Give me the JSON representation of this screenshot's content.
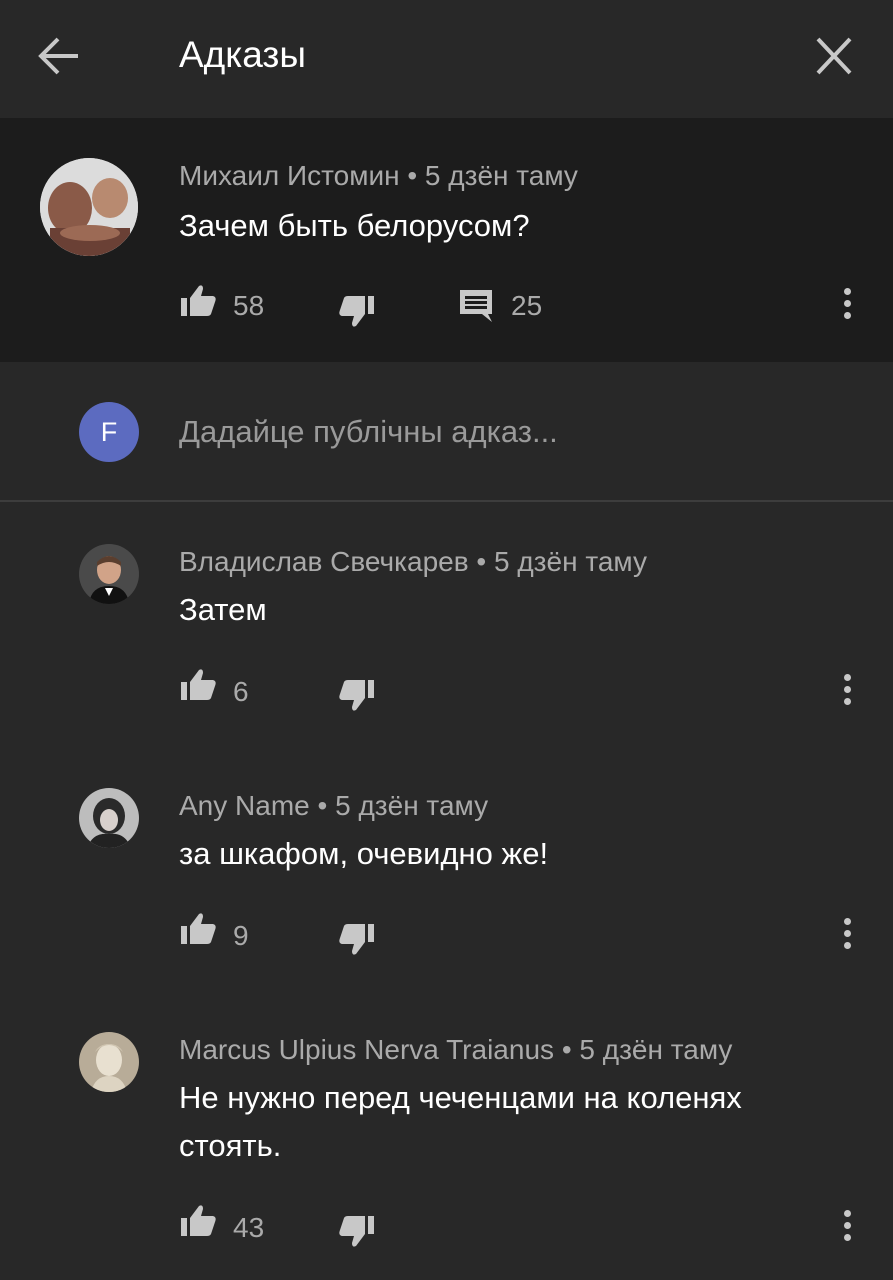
{
  "header": {
    "title": "Адказы",
    "back_icon": "arrow-left-icon",
    "close_icon": "close-icon"
  },
  "parent_comment": {
    "author": "Михаил Истомин",
    "time": "5 дзён таму",
    "text": "Зачем быть белорусом?",
    "likes": "58",
    "replies": "25"
  },
  "reply_box": {
    "avatar_letter": "F",
    "placeholder": "Дадайце публічны адказ..."
  },
  "replies": [
    {
      "author": "Владислав Свечкарев",
      "time": "5 дзён таму",
      "text": "Затем",
      "likes": "6"
    },
    {
      "author": "Any Name",
      "time": "5 дзён таму",
      "text": "за шкафом, очевидно же!",
      "likes": "9"
    },
    {
      "author": "Marcus Ulpius Nerva Traianus",
      "time": "5 дзён таму",
      "text": "Не нужно перед чеченцами на коленях стоять.",
      "likes": "43"
    }
  ],
  "separator": "•",
  "colors": {
    "background": "#282828",
    "parent_background": "#1c1c1c",
    "avatar_f": "#5c6bc0",
    "notification": "#e31c1c"
  }
}
